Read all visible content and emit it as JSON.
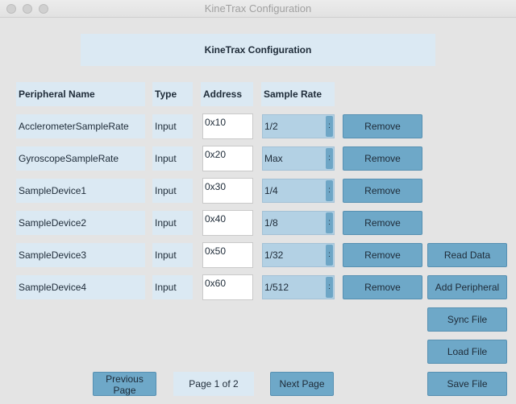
{
  "window": {
    "title": "KineTrax Configuration"
  },
  "banner": {
    "title": "KineTrax Configuration"
  },
  "columns": {
    "name": "Peripheral Name",
    "type": "Type",
    "address": "Address",
    "rate": "Sample Rate"
  },
  "rows": [
    {
      "name": "AcclerometerSampleRate",
      "type": "Input",
      "address": "0x10",
      "rate": "1/2",
      "remove": "Remove"
    },
    {
      "name": "GyroscopeSampleRate",
      "type": "Input",
      "address": "0x20",
      "rate": "Max",
      "remove": "Remove"
    },
    {
      "name": "SampleDevice1",
      "type": "Input",
      "address": "0x30",
      "rate": "1/4",
      "remove": "Remove"
    },
    {
      "name": "SampleDevice2",
      "type": "Input",
      "address": "0x40",
      "rate": "1/8",
      "remove": "Remove"
    },
    {
      "name": "SampleDevice3",
      "type": "Input",
      "address": "0x50",
      "rate": "1/32",
      "remove": "Remove"
    },
    {
      "name": "SampleDevice4",
      "type": "Input",
      "address": "0x60",
      "rate": "1/512",
      "remove": "Remove"
    }
  ],
  "actions": {
    "read_data": "Read Data",
    "add_peripheral": "Add Peripheral",
    "sync_file": "Sync File",
    "load_file": "Load File",
    "save_file": "Save File"
  },
  "pagination": {
    "previous_line1": "Previous",
    "previous_line2": "Page",
    "info": "Page 1 of 2",
    "next": "Next Page"
  },
  "select_arrow_glyph": ":"
}
